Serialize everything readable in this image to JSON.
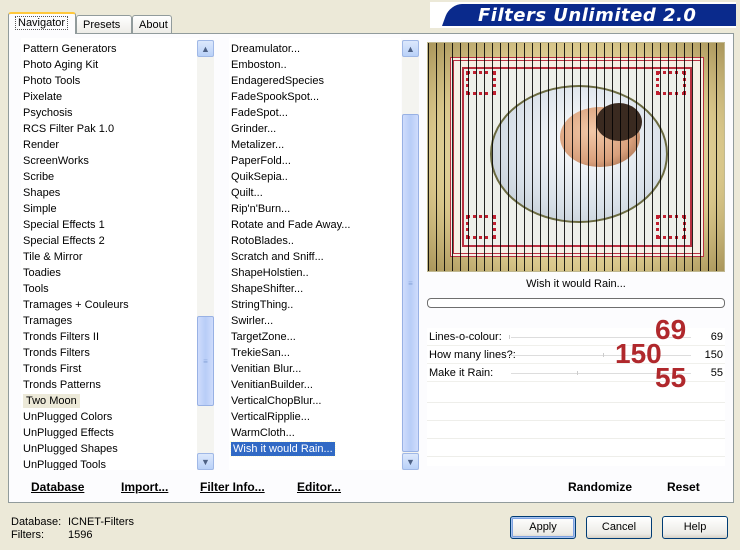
{
  "tabs": [
    {
      "label": "Navigator",
      "active": true
    },
    {
      "label": "Presets",
      "active": false
    },
    {
      "label": "About",
      "active": false
    }
  ],
  "banner": {
    "title": "Filters Unlimited 2.0"
  },
  "categories": {
    "items": [
      "Pattern Generators",
      "Photo Aging Kit",
      "Photo Tools",
      "Pixelate",
      "Psychosis",
      "RCS Filter Pak 1.0",
      "Render",
      "ScreenWorks",
      "Scribe",
      "Shapes",
      "Simple",
      "Special Effects 1",
      "Special Effects 2",
      "Tile & Mirror",
      "Toadies",
      "Tools",
      "Tramages + Couleurs",
      "Tramages",
      "Tronds Filters II",
      "Tronds Filters",
      "Tronds First",
      "Tronds Patterns",
      "Two Moon",
      "UnPlugged Colors",
      "UnPlugged Effects",
      "UnPlugged Shapes",
      "UnPlugged Tools"
    ],
    "highlighted": "Two Moon"
  },
  "filters": {
    "items": [
      "Dreamulator...",
      "Emboston..",
      "EndageredSpecies",
      "FadeSpookSpot...",
      "FadeSpot...",
      "Grinder...",
      "Metalizer...",
      "PaperFold...",
      "QuikSepia..",
      "Quilt...",
      "Rip'n'Burn...",
      "Rotate and Fade Away...",
      "RotoBlades..",
      "Scratch and Sniff...",
      "ShapeHolstien..",
      "ShapeShifter...",
      "StringThing..",
      "Swirler...",
      "TargetZone...",
      "TrekieSan...",
      "Venitian Blur...",
      "VenitianBuilder...",
      "VerticalChopBlur...",
      "VerticalRipplie...",
      "WarmCloth...",
      "Wish it would Rain..."
    ],
    "selected": "Wish it would Rain..."
  },
  "preview": {
    "label": "Wish it would Rain..."
  },
  "params": [
    {
      "label": "Lines-o-colour:",
      "value": "69",
      "overlay": "69"
    },
    {
      "label": "How many lines?:",
      "value": "150",
      "overlay": "150"
    },
    {
      "label": "Make it Rain:",
      "value": "55",
      "overlay": "55"
    }
  ],
  "actions": {
    "database": "Database",
    "import": "Import...",
    "filter_info": "Filter Info...",
    "editor": "Editor...",
    "randomize": "Randomize",
    "reset": "Reset"
  },
  "footer": {
    "database_label": "Database:",
    "database_value": "ICNET-Filters",
    "filters_label": "Filters:",
    "filters_value": "1596",
    "apply": "Apply",
    "cancel": "Cancel",
    "help": "Help"
  },
  "colors": {
    "banner": "#0a2a8c",
    "selection": "#316ac5",
    "overlay_numbers": "#b0282c"
  }
}
